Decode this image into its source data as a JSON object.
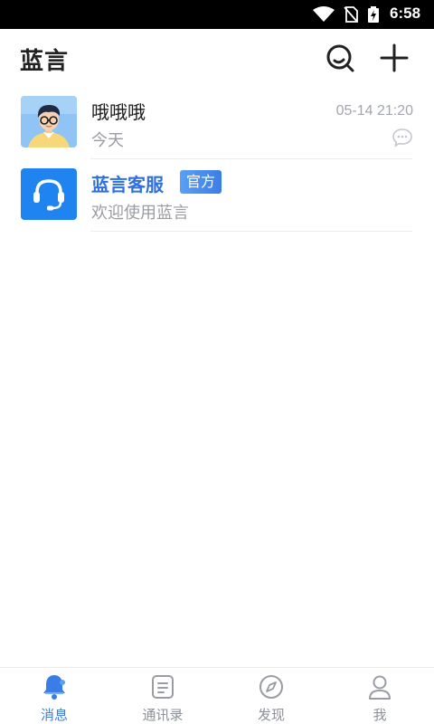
{
  "status_bar": {
    "time": "6:58",
    "icons": [
      "wifi-icon",
      "no-sim-icon",
      "battery-charging-icon"
    ]
  },
  "header": {
    "title": "蓝言",
    "buttons": [
      "search-icon",
      "add-icon"
    ]
  },
  "conversations": [
    {
      "name": "哦哦哦",
      "preview": "今天",
      "time": "05-14 21:20",
      "avatar": "user-avatar",
      "icon": "chat-bubble-icon"
    },
    {
      "name": "蓝言客服",
      "badge": "官方",
      "preview": "欢迎使用蓝言",
      "avatar": "headset-icon"
    }
  ],
  "bottom_nav": {
    "items": [
      {
        "label": "消息",
        "icon": "bell-icon",
        "active": true
      },
      {
        "label": "通讯录",
        "icon": "contacts-icon",
        "active": false
      },
      {
        "label": "发现",
        "icon": "compass-icon",
        "active": false
      },
      {
        "label": "我",
        "icon": "person-icon",
        "active": false
      }
    ]
  },
  "colors": {
    "accent": "#3b7de6",
    "status_bar": "#000000",
    "inactive": "#8d9098"
  }
}
